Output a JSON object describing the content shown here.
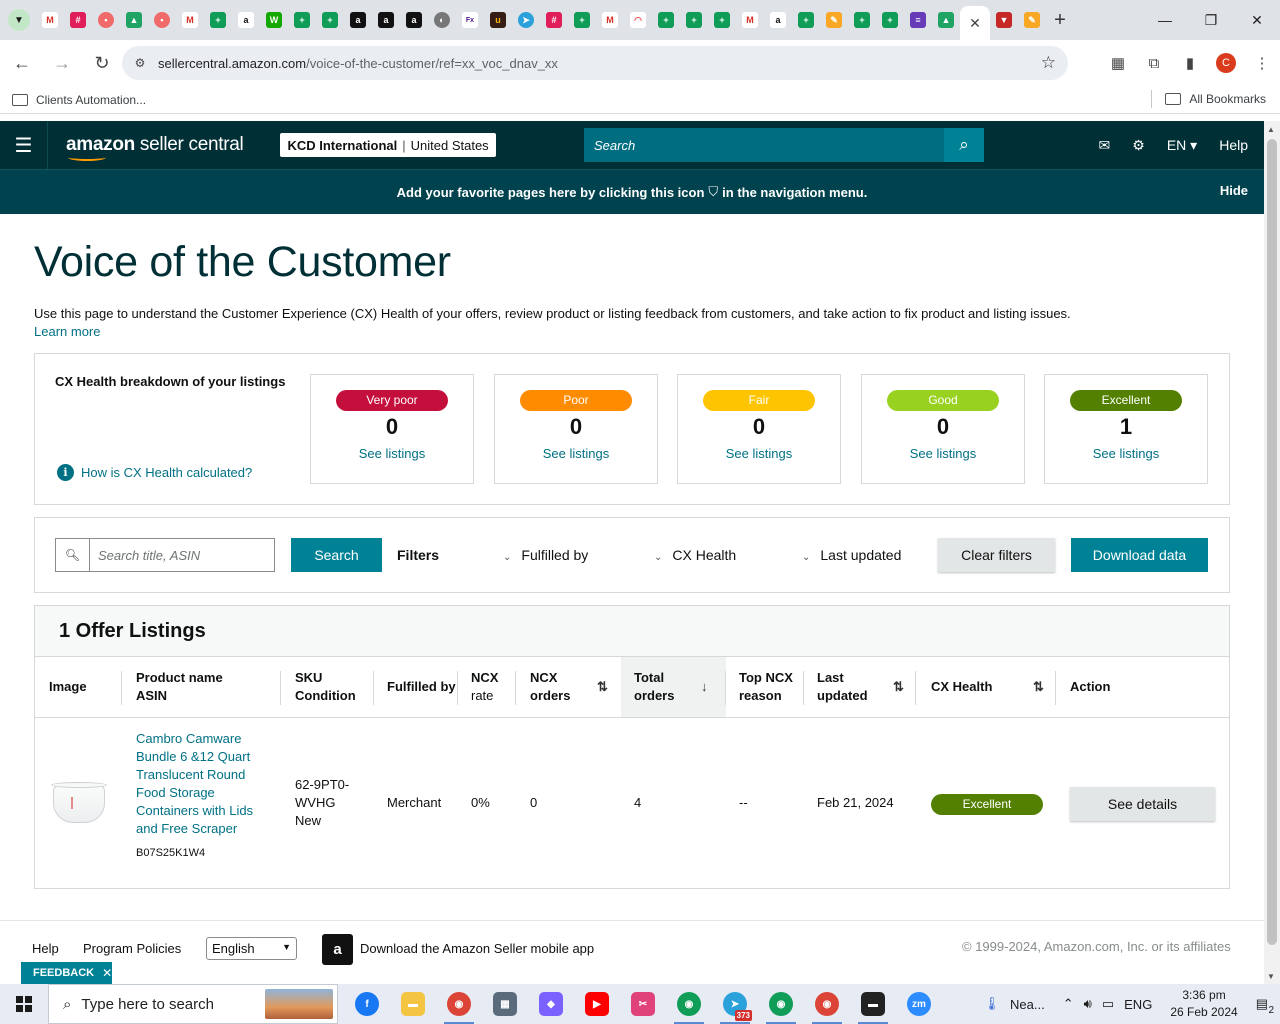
{
  "browser": {
    "url_host": "sellercentral.amazon.com",
    "url_path": "/voice-of-the-customer/ref=xx_voc_dnav_xx",
    "profile_initial": "C",
    "bookmarks": {
      "left_label": "Clients Automation...",
      "right_label": "All Bookmarks"
    }
  },
  "header": {
    "logo_bold": "amazon",
    "logo_rest": " seller central",
    "account_name": "KCD International",
    "account_region": "United States",
    "search_placeholder": "Search",
    "lang": "EN",
    "help": "Help"
  },
  "banner": {
    "text_before": "Add your favorite pages here by clicking this icon",
    "text_after": "in the navigation menu.",
    "hide": "Hide"
  },
  "page": {
    "title": "Voice of the Customer",
    "intro": "Use this page to understand the Customer Experience (CX) Health of your offers, review product or listing feedback from customers, and take action to fix product and listing issues.",
    "learn_more": "Learn more"
  },
  "cx_breakdown": {
    "title": "CX Health breakdown of your listings",
    "how_link": "How is CX Health calculated?",
    "buckets": [
      {
        "label": "Very poor",
        "count": "0",
        "link": "See listings",
        "color": "#c40e3c"
      },
      {
        "label": "Poor",
        "count": "0",
        "link": "See listings",
        "color": "#ff8c00"
      },
      {
        "label": "Fair",
        "count": "0",
        "link": "See listings",
        "color": "#ffc400"
      },
      {
        "label": "Good",
        "count": "0",
        "link": "See listings",
        "color": "#98d11f"
      },
      {
        "label": "Excellent",
        "count": "1",
        "link": "See listings",
        "color": "#538000"
      }
    ]
  },
  "filters": {
    "search_placeholder": "Search title, ASIN",
    "search_button": "Search",
    "filters_label": "Filters",
    "fulfilled_by": "Fulfilled by",
    "cx_health": "CX Health",
    "last_updated": "Last updated",
    "clear": "Clear filters",
    "download": "Download data"
  },
  "listings": {
    "heading": "1 Offer Listings",
    "columns": {
      "image": "Image",
      "product_name": "Product name",
      "asin": "ASIN",
      "sku": "SKU",
      "condition": "Condition",
      "fulfilled_by": "Fulfilled by",
      "ncx_rate_1": "NCX",
      "ncx_rate_2": "rate",
      "ncx_orders_1": "NCX",
      "ncx_orders_2": "orders",
      "total_orders_1": "Total",
      "total_orders_2": "orders",
      "top_ncx_1": "Top NCX",
      "top_ncx_2": "reason",
      "last_updated_1": "Last",
      "last_updated_2": "updated",
      "cx_health": "CX Health",
      "action": "Action"
    },
    "rows": [
      {
        "product_name": "Cambro Camware Bundle 6 &12 Quart Translucent Round Food Storage Containers with Lids and Free Scraper",
        "asin": "B07S25K1W4",
        "sku": "62-9PT0-WVHG",
        "condition": "New",
        "fulfilled_by": "Merchant",
        "ncx_rate": "0%",
        "ncx_orders": "0",
        "total_orders": "4",
        "top_ncx_reason": "--",
        "last_updated": "Feb 21, 2024",
        "cx_health": "Excellent",
        "action": "See details"
      }
    ]
  },
  "footer": {
    "help": "Help",
    "policies": "Program Policies",
    "language": "English",
    "app_text": "Download the Amazon Seller mobile app",
    "copyright": "© 1999-2024, Amazon.com, Inc. or its affiliates",
    "feedback": "FEEDBACK"
  },
  "taskbar": {
    "search_placeholder": "Type here to search",
    "weather": "Nea...",
    "lang": "ENG",
    "time": "3:36 pm",
    "date": "26 Feb 2024",
    "telegram_badge": "373",
    "notif_count": "2"
  }
}
